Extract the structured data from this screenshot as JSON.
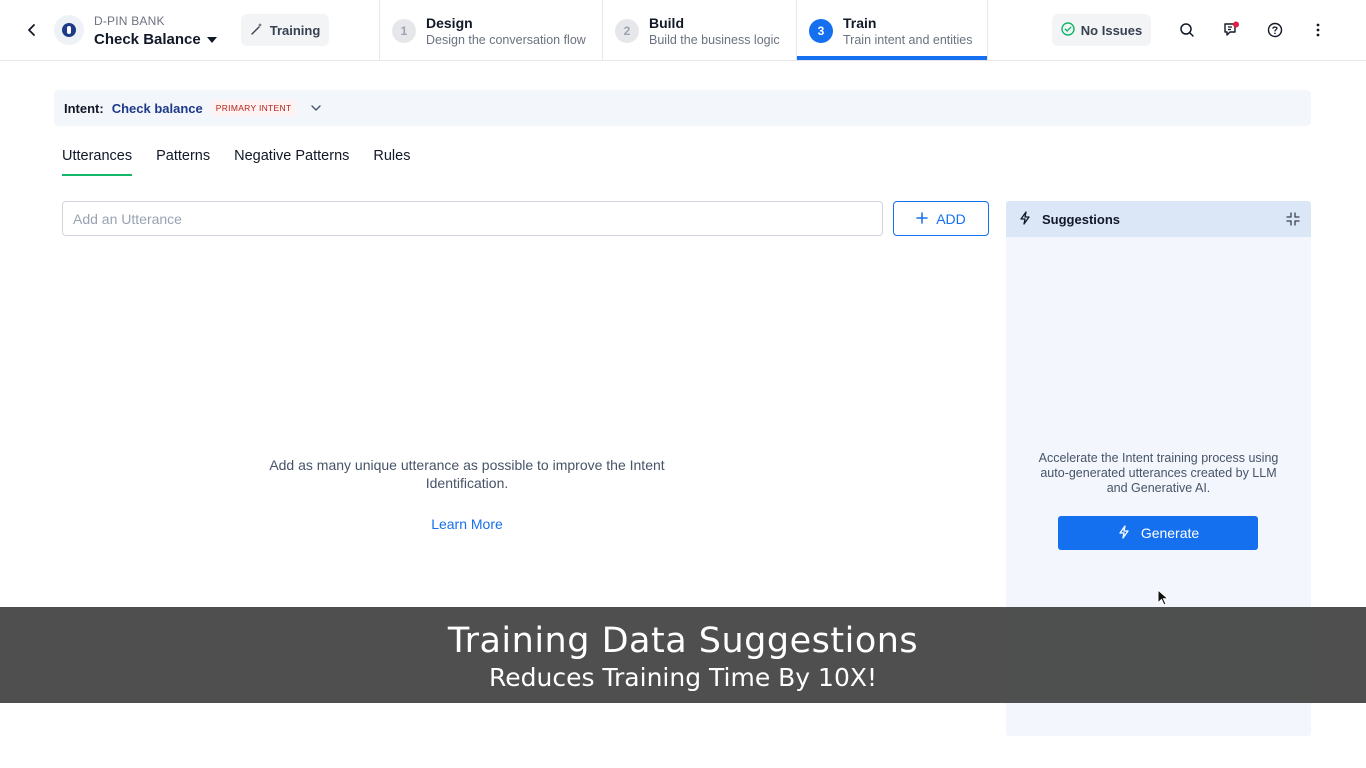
{
  "header": {
    "bank_name": "D-PIN BANK",
    "bot_name": "Check Balance",
    "mode_label": "Training",
    "steps": [
      {
        "num": "1",
        "title": "Design",
        "sub": "Design the conversation flow"
      },
      {
        "num": "2",
        "title": "Build",
        "sub": "Build the business logic"
      },
      {
        "num": "3",
        "title": "Train",
        "sub": "Train intent and entities"
      }
    ],
    "active_step": "3",
    "issues_label": "No Issues"
  },
  "intent": {
    "label": "Intent:",
    "value": "Check balance",
    "badge": "PRIMARY INTENT"
  },
  "tabs": [
    "Utterances",
    "Patterns",
    "Negative Patterns",
    "Rules"
  ],
  "active_tab": "Utterances",
  "utterance": {
    "placeholder": "Add an Utterance",
    "add_label": "ADD",
    "empty_message": "Add as many unique utterance as possible to improve the Intent Identification.",
    "learn_more": "Learn More"
  },
  "suggestions": {
    "title": "Suggestions",
    "description": "Accelerate the Intent training process using auto-generated utterances created by LLM and Generative AI.",
    "generate_label": "Generate"
  },
  "banner": {
    "title": "Training Data Suggestions",
    "subtitle": "Reduces Training Time By 10X!"
  },
  "colors": {
    "accent": "#1570ef",
    "tab_underline": "#12b76a",
    "notification_dot": "#e11d48"
  },
  "icons": [
    "chevron-left-icon",
    "bot-logo-icon",
    "magic-wand-icon",
    "check-circle-icon",
    "search-icon",
    "feedback-icon",
    "help-icon",
    "more-vertical-icon",
    "chevron-down-icon",
    "plus-icon",
    "lightning-icon",
    "collapse-icon"
  ]
}
